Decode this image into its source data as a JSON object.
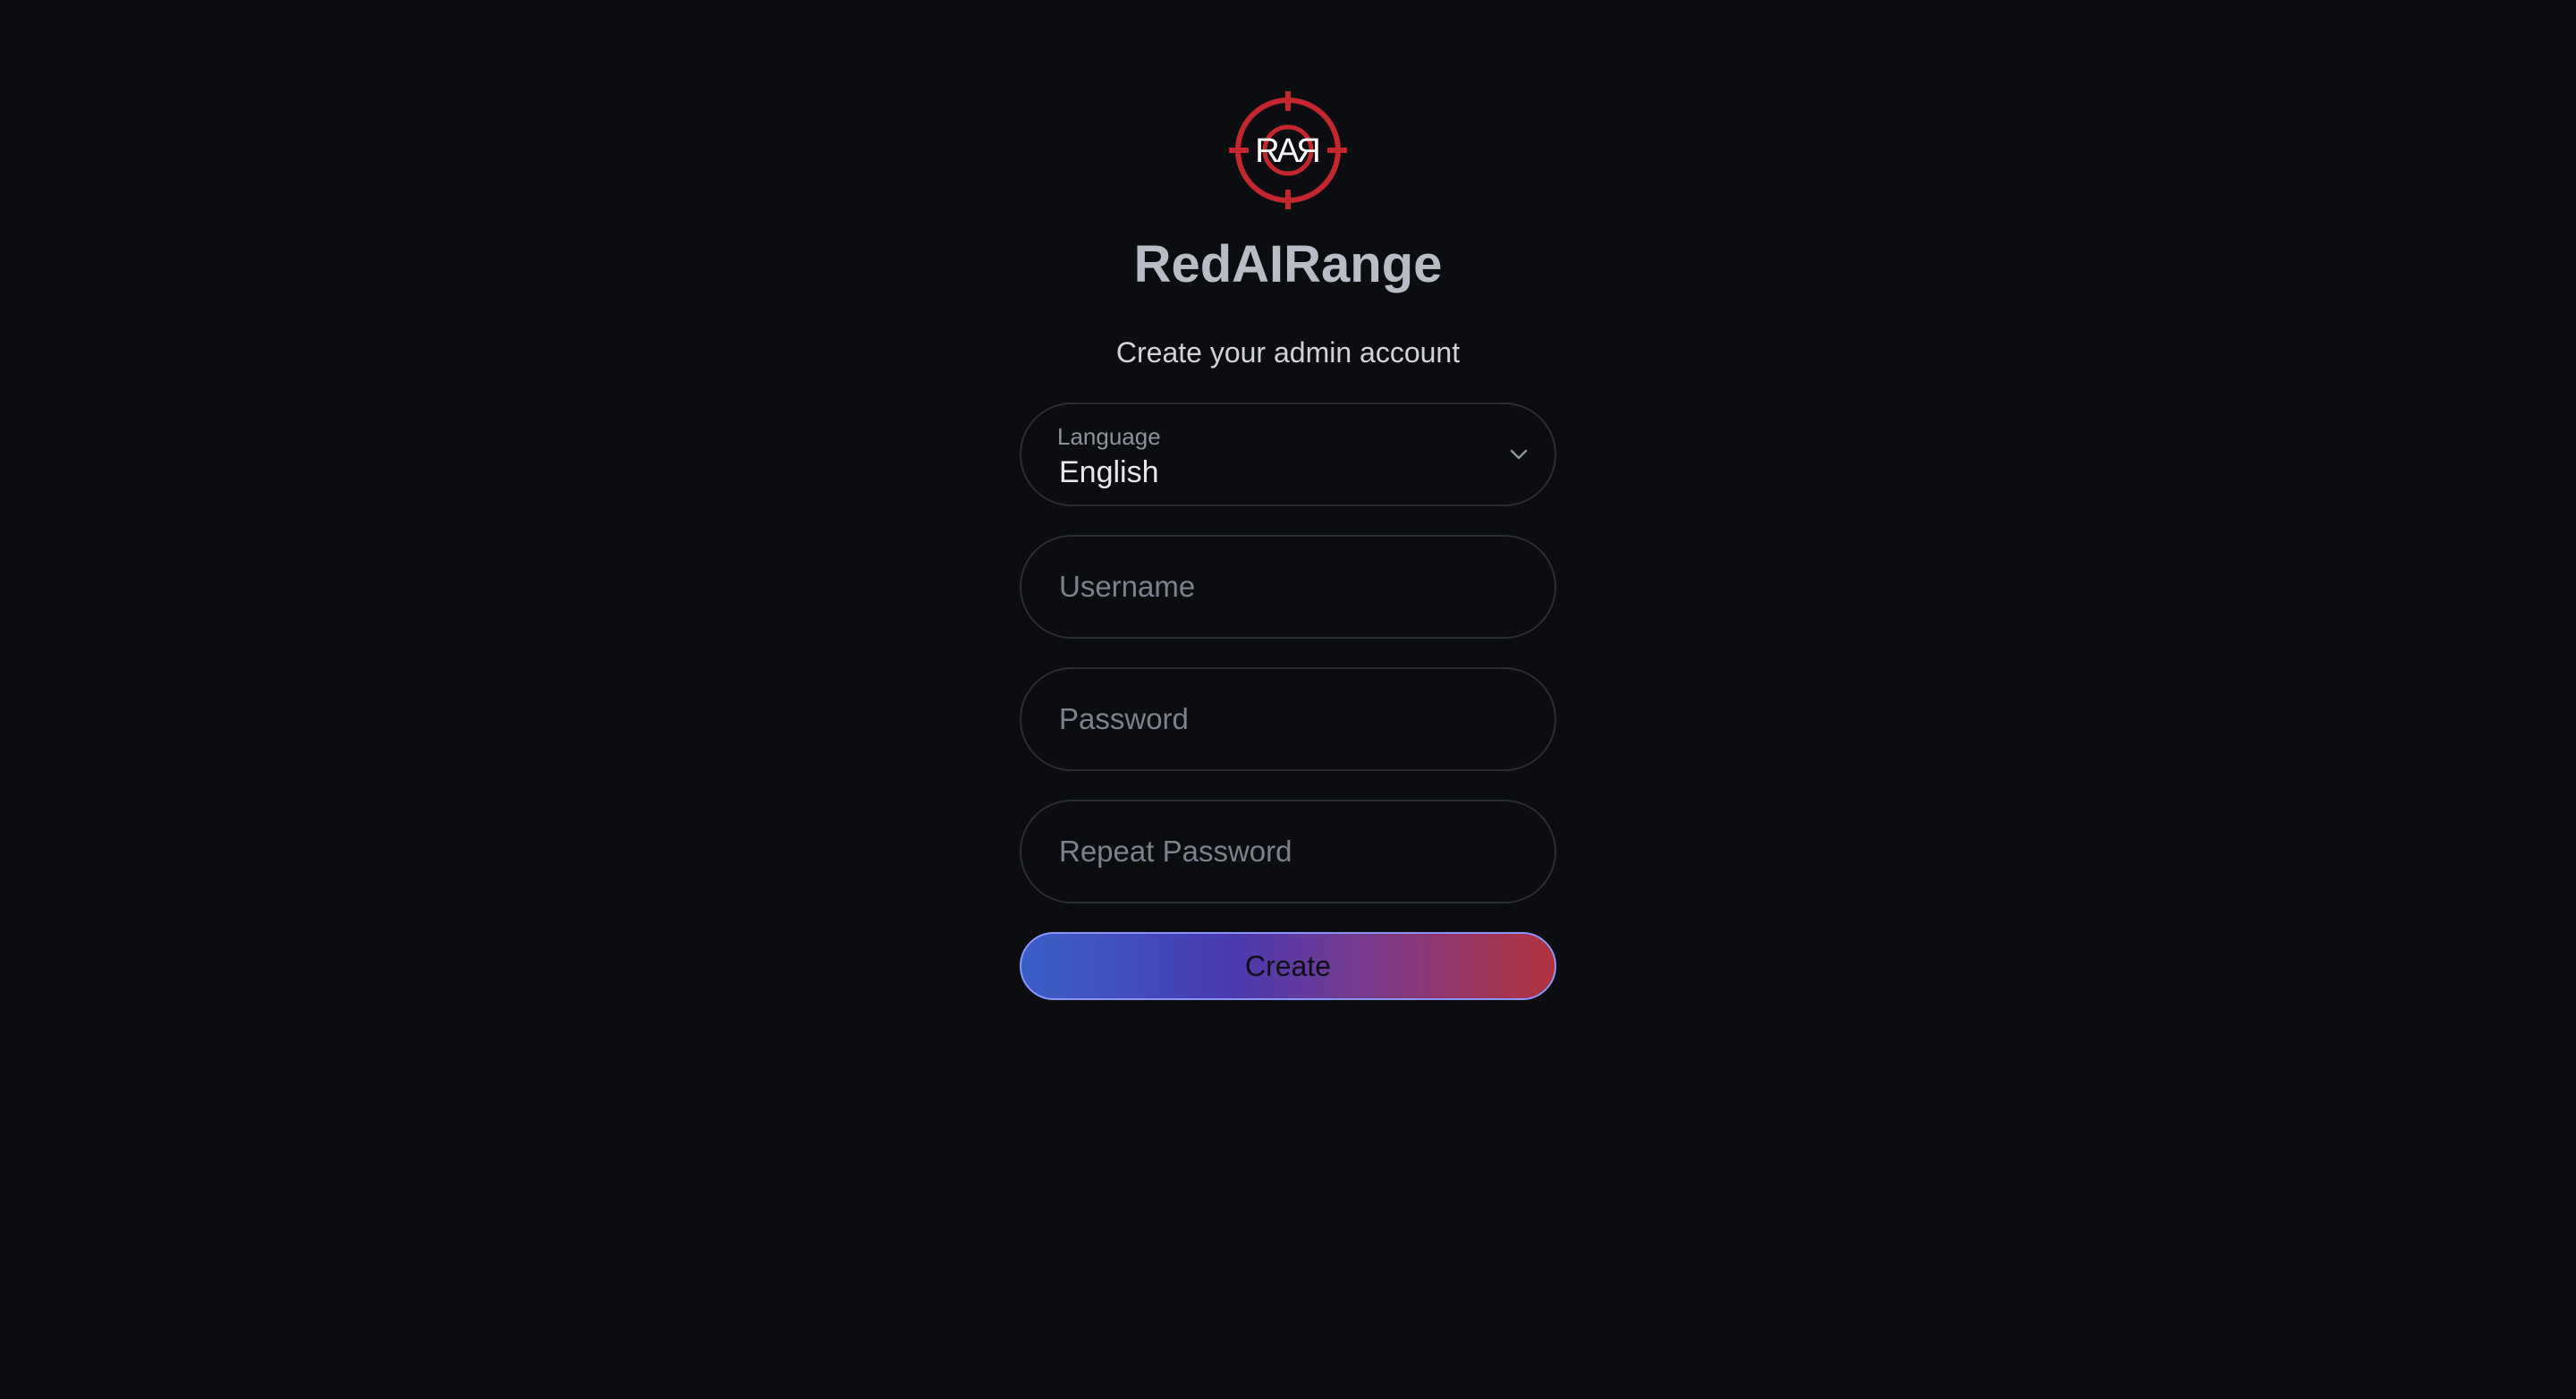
{
  "app": {
    "logo_text": "RAR",
    "title": "RedAIRange",
    "subtitle": "Create your admin account"
  },
  "colors": {
    "background": "#0b0d11",
    "logo_red": "#c4262e",
    "button_gradient_start": "#3a5fc8",
    "button_gradient_end": "#b0323c"
  },
  "form": {
    "language": {
      "label": "Language",
      "value": "English",
      "icon": "chevron-down-icon"
    },
    "username": {
      "placeholder": "Username",
      "value": ""
    },
    "password": {
      "placeholder": "Password",
      "value": ""
    },
    "repeat_password": {
      "placeholder": "Repeat Password",
      "value": ""
    },
    "submit_label": "Create"
  }
}
